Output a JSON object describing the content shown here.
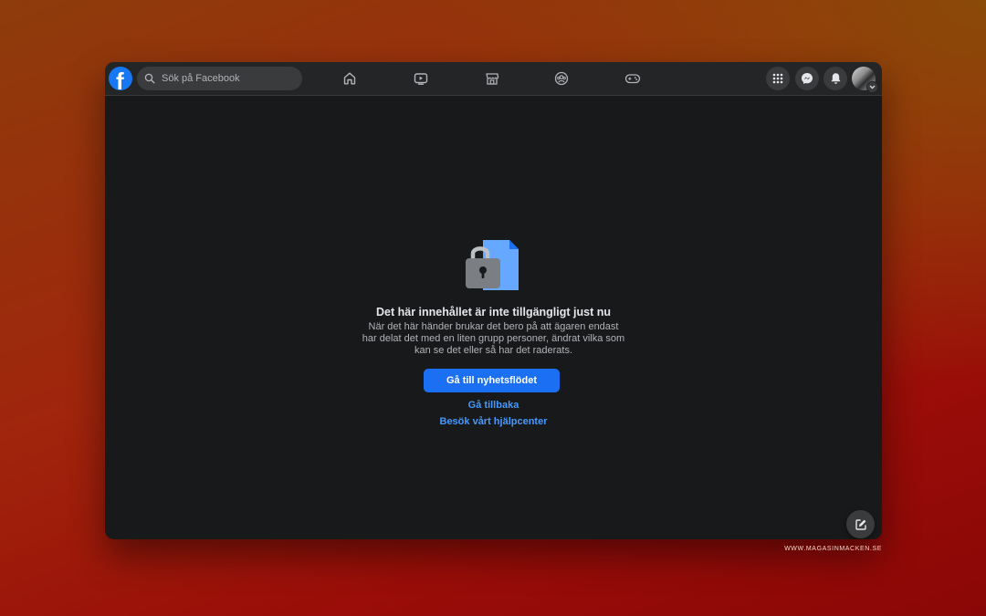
{
  "header": {
    "logo_letter": "f",
    "search": {
      "placeholder": "Sök på Facebook"
    },
    "nav": [
      {
        "name": "home",
        "icon": "home-icon"
      },
      {
        "name": "watch",
        "icon": "watch-video-icon"
      },
      {
        "name": "marketplace",
        "icon": "marketplace-store-icon"
      },
      {
        "name": "groups",
        "icon": "groups-icon"
      },
      {
        "name": "gaming",
        "icon": "gaming-controller-icon"
      }
    ],
    "right_buttons": [
      {
        "name": "menu",
        "icon": "grid-menu-icon"
      },
      {
        "name": "messenger",
        "icon": "messenger-icon"
      },
      {
        "name": "notifications",
        "icon": "bell-icon"
      },
      {
        "name": "account",
        "icon": "avatar"
      }
    ]
  },
  "main": {
    "title": "Det här innehållet är inte tillgängligt just nu",
    "description_lines": [
      "När det här händer brukar det bero på att ägaren endast",
      "har delat det med en liten grupp personer, ändrat vilka som",
      "kan se det eller så har det raderats."
    ],
    "primary_button": "Gå till nyhetsflödet",
    "back_link": "Gå tillbaka",
    "help_link": "Besök vårt hjälpcenter"
  },
  "watermark": "WWW.MAGASINMACKEN.SE",
  "colors": {
    "accent": "#1b6ff2",
    "link": "#4599ff",
    "page_background": "#18191a",
    "topbar": "#242526"
  }
}
